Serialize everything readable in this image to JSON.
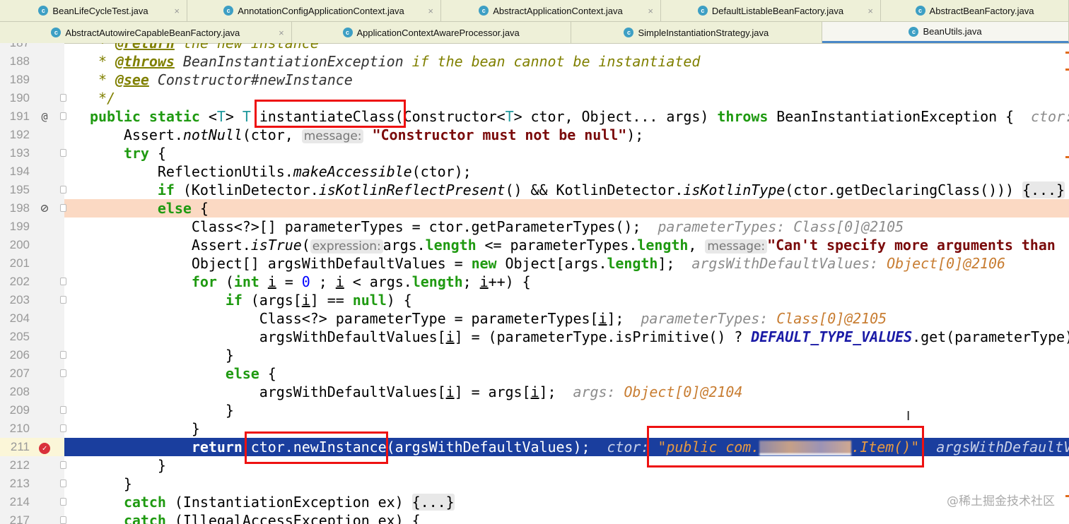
{
  "tabs_row1": [
    {
      "label": "BeanLifeCycleTest.java",
      "closable": true
    },
    {
      "label": "AnnotationConfigApplicationContext.java",
      "closable": true
    },
    {
      "label": "AbstractApplicationContext.java",
      "closable": true
    },
    {
      "label": "DefaultListableBeanFactory.java",
      "closable": true
    },
    {
      "label": "AbstractBeanFactory.java",
      "closable": false
    }
  ],
  "tabs_row2": [
    {
      "label": "AbstractAutowireCapableBeanFactory.java",
      "closable": true
    },
    {
      "label": "ApplicationContextAwareProcessor.java",
      "closable": false
    },
    {
      "label": "SimpleInstantiationStrategy.java",
      "closable": false
    },
    {
      "label": "BeanUtils.java",
      "closable": false,
      "active": true
    }
  ],
  "tab_icon": "class-icon",
  "colors": {
    "keyword": "#1f9a11",
    "execution_line": "#1a3e9e",
    "disabled_breakpoint_line": "#fbd9c3",
    "highlight_box": "#ee1111"
  },
  "lines": [
    {
      "n": "187",
      "seg": [
        [
          "c",
          "     * "
        ],
        [
          "ct",
          "@return"
        ],
        [
          "c",
          " the new instance"
        ]
      ]
    },
    {
      "n": "188",
      "seg": [
        [
          "c",
          "     * "
        ],
        [
          "ct",
          "@throws"
        ],
        [
          "cr",
          " BeanInstantiationException"
        ],
        [
          "c",
          " if the bean cannot be instantiated"
        ]
      ]
    },
    {
      "n": "189",
      "seg": [
        [
          "c",
          "     * "
        ],
        [
          "ct",
          "@see"
        ],
        [
          "cr",
          " Constructor#newInstance"
        ]
      ]
    },
    {
      "n": "190",
      "fold": true,
      "seg": [
        [
          "c",
          "     */"
        ]
      ]
    },
    {
      "n": "191",
      "mark": "@",
      "fold": true,
      "seg": [
        [
          "t",
          "    "
        ],
        [
          "k",
          "public static"
        ],
        [
          "t",
          " <"
        ],
        [
          "tp",
          "T"
        ],
        [
          "t",
          "> "
        ],
        [
          "tp",
          "T"
        ],
        [
          "t",
          " instantiateClass(Constructor<"
        ],
        [
          "tp",
          "T"
        ],
        [
          "t",
          "> ctor, Object... args) "
        ],
        [
          "k",
          "throws"
        ],
        [
          "t",
          " BeanInstantiationException {  "
        ],
        [
          "dv",
          "ctor: "
        ]
      ]
    },
    {
      "n": "192",
      "seg": [
        [
          "t",
          "        Assert."
        ],
        [
          "m",
          "notNull"
        ],
        [
          "t",
          "(ctor, "
        ],
        [
          "h",
          "message:"
        ],
        [
          "t",
          " "
        ],
        [
          "s",
          "\"Constructor must not be null\""
        ],
        [
          "t",
          ");"
        ]
      ]
    },
    {
      "n": "193",
      "fold": true,
      "seg": [
        [
          "t",
          "        "
        ],
        [
          "k",
          "try"
        ],
        [
          "t",
          " {"
        ]
      ]
    },
    {
      "n": "194",
      "seg": [
        [
          "t",
          "            ReflectionUtils."
        ],
        [
          "m",
          "makeAccessible"
        ],
        [
          "t",
          "(ctor);"
        ]
      ]
    },
    {
      "n": "195",
      "fold": true,
      "seg": [
        [
          "t",
          "            "
        ],
        [
          "k",
          "if"
        ],
        [
          "t",
          " (KotlinDetector."
        ],
        [
          "m",
          "isKotlinReflectPresent"
        ],
        [
          "t",
          "() && KotlinDetector."
        ],
        [
          "m",
          "isKotlinType"
        ],
        [
          "t",
          "(ctor.getDeclaringClass())) "
        ],
        [
          "fb",
          "{...}"
        ],
        [
          "t",
          " }"
        ]
      ]
    },
    {
      "n": "198",
      "mark": "⊘",
      "fold": true,
      "bg": "peach",
      "seg": [
        [
          "t",
          "            "
        ],
        [
          "k",
          "else"
        ],
        [
          "t",
          " {"
        ]
      ]
    },
    {
      "n": "199",
      "seg": [
        [
          "t",
          "                Class<?>[] parameterTypes = ctor.getParameterTypes();  "
        ],
        [
          "dv",
          "parameterTypes: Class[0]@2105"
        ]
      ]
    },
    {
      "n": "200",
      "seg": [
        [
          "t",
          "                Assert."
        ],
        [
          "m",
          "isTrue"
        ],
        [
          "t",
          "("
        ],
        [
          "h",
          "expression:"
        ],
        [
          "t",
          "args."
        ],
        [
          "k",
          "length"
        ],
        [
          "t",
          " <= parameterTypes."
        ],
        [
          "k",
          "length"
        ],
        [
          "t",
          ", "
        ],
        [
          "h",
          "message:"
        ],
        [
          "s",
          "\"Can't specify more arguments than"
        ]
      ]
    },
    {
      "n": "201",
      "seg": [
        [
          "t",
          "                Object[] argsWithDefaultValues = "
        ],
        [
          "k",
          "new"
        ],
        [
          "t",
          " Object[args."
        ],
        [
          "k",
          "length"
        ],
        [
          "t",
          "];  "
        ],
        [
          "dv",
          "argsWithDefaultValues: "
        ],
        [
          "do",
          "Object[0]@2106"
        ]
      ]
    },
    {
      "n": "202",
      "fold": true,
      "seg": [
        [
          "t",
          "                "
        ],
        [
          "k",
          "for"
        ],
        [
          "t",
          " ("
        ],
        [
          "k",
          "int"
        ],
        [
          "t",
          " "
        ],
        [
          "u",
          "i"
        ],
        [
          "t",
          " = "
        ],
        [
          "n",
          "0"
        ],
        [
          "t",
          " ; "
        ],
        [
          "u",
          "i"
        ],
        [
          "t",
          " < args."
        ],
        [
          "k",
          "length"
        ],
        [
          "t",
          "; "
        ],
        [
          "u",
          "i"
        ],
        [
          "t",
          "++) {"
        ]
      ]
    },
    {
      "n": "203",
      "fold": true,
      "seg": [
        [
          "t",
          "                    "
        ],
        [
          "k",
          "if"
        ],
        [
          "t",
          " (args["
        ],
        [
          "u",
          "i"
        ],
        [
          "t",
          "] == "
        ],
        [
          "k",
          "null"
        ],
        [
          "t",
          ") {"
        ]
      ]
    },
    {
      "n": "204",
      "seg": [
        [
          "t",
          "                        Class<?> parameterType = parameterTypes["
        ],
        [
          "u",
          "i"
        ],
        [
          "t",
          "];  "
        ],
        [
          "dv",
          "parameterTypes: "
        ],
        [
          "do",
          "Class[0]@2105"
        ]
      ]
    },
    {
      "n": "205",
      "seg": [
        [
          "t",
          "                        argsWithDefaultValues["
        ],
        [
          "u",
          "i"
        ],
        [
          "t",
          "] = (parameterType.isPrimitive() ? "
        ],
        [
          "st",
          "DEFAULT_TYPE_VALUES"
        ],
        [
          "t",
          ".get(parameterType)"
        ]
      ]
    },
    {
      "n": "206",
      "fold": true,
      "seg": [
        [
          "t",
          "                    }"
        ]
      ]
    },
    {
      "n": "207",
      "fold": true,
      "seg": [
        [
          "t",
          "                    "
        ],
        [
          "k",
          "else"
        ],
        [
          "t",
          " {"
        ]
      ]
    },
    {
      "n": "208",
      "seg": [
        [
          "t",
          "                        argsWithDefaultValues["
        ],
        [
          "u",
          "i"
        ],
        [
          "t",
          "] = args["
        ],
        [
          "u",
          "i"
        ],
        [
          "t",
          "];  "
        ],
        [
          "dv",
          "args: "
        ],
        [
          "do",
          "Object[0]@2104"
        ]
      ]
    },
    {
      "n": "209",
      "fold": true,
      "seg": [
        [
          "t",
          "                    }"
        ]
      ]
    },
    {
      "n": "210",
      "fold": true,
      "seg": [
        [
          "t",
          "                }"
        ]
      ]
    },
    {
      "n": "211",
      "mark": "bp",
      "bg": "exec",
      "seg": [
        [
          "t",
          "                "
        ],
        [
          "k",
          "return"
        ],
        [
          "t",
          " ctor.newInstance(argsWithDefaultValues);  "
        ],
        [
          "dv",
          "ctor: "
        ],
        [
          "do",
          "\"public com."
        ],
        [
          "blur",
          ""
        ],
        [
          "do",
          ".Item()\""
        ],
        [
          "dv",
          "  argsWithDefaultValues"
        ]
      ]
    },
    {
      "n": "212",
      "fold": true,
      "seg": [
        [
          "t",
          "            }"
        ]
      ]
    },
    {
      "n": "213",
      "fold": true,
      "seg": [
        [
          "t",
          "        }"
        ]
      ]
    },
    {
      "n": "214",
      "fold": true,
      "seg": [
        [
          "t",
          "        "
        ],
        [
          "k",
          "catch"
        ],
        [
          "t",
          " (InstantiationException ex) "
        ],
        [
          "fb",
          "{...}"
        ]
      ]
    },
    {
      "n": "217",
      "fold": true,
      "seg": [
        [
          "t",
          "        "
        ],
        [
          "k",
          "catch"
        ],
        [
          "t",
          " (IllegalAccessException ex) {"
        ]
      ]
    }
  ],
  "watermark": "@稀土掘金技术社区"
}
